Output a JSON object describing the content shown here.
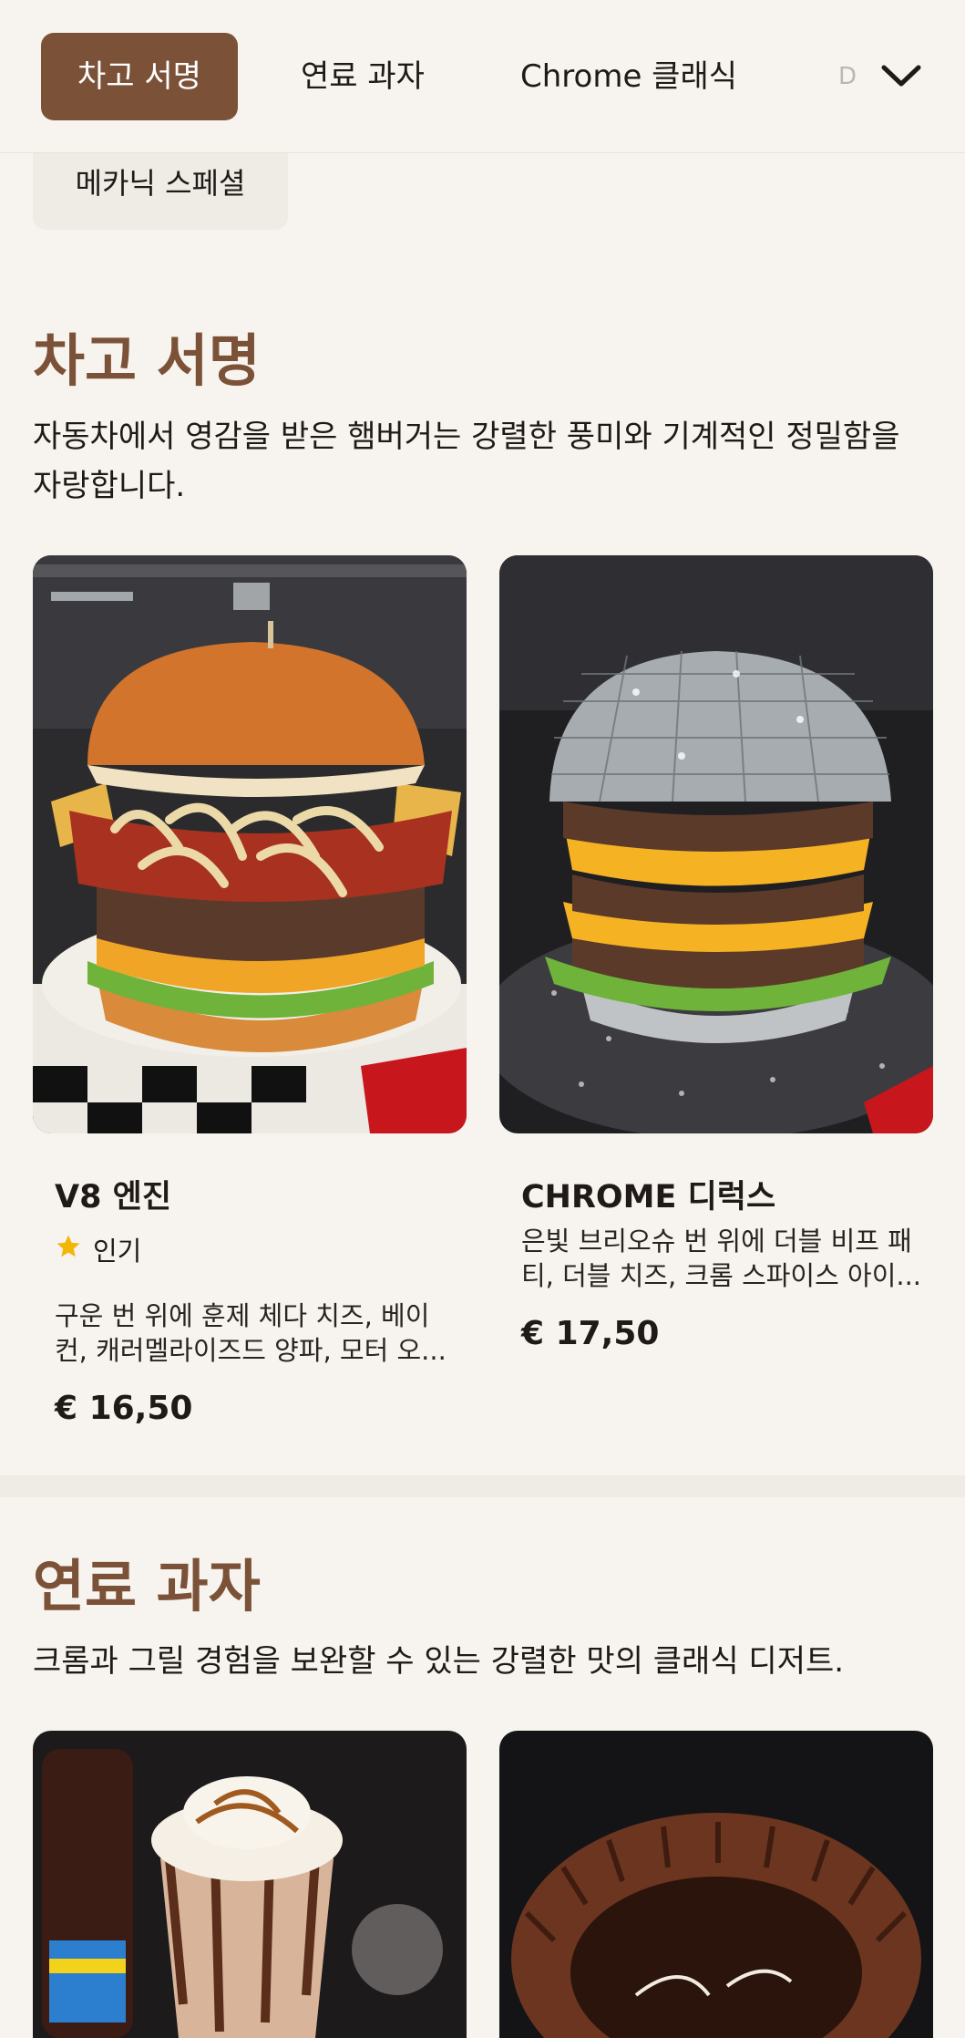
{
  "tabs": [
    {
      "label": "차고 서명"
    },
    {
      "label": "연료 과자"
    },
    {
      "label": "Chrome 클래식"
    },
    {
      "label": "D"
    },
    {
      "label": "메카닉 스페셜"
    }
  ],
  "sections": [
    {
      "title": "차고 서명",
      "description": "자동차에서 영감을 받은 햄버거는 강렬한 풍미와 기계적인 정밀함을 자랑합니다.",
      "items": [
        {
          "title": "V8 엔진",
          "badge": "인기",
          "description": "구운 번 위에 훈제 체다 치즈, 베이컨, 캐러멜라이즈드 양파, 모터 오...",
          "price": "€ 16,50"
        },
        {
          "title": "CHROME 디럭스",
          "description": "은빛 브리오슈 번 위에 더블 비프 패티, 더블 치즈, 크롬 스파이스 아이...",
          "price": "€ 17,50"
        }
      ]
    },
    {
      "title": "연료 과자",
      "description": "크롬과 그릴 경험을 보완할 수 있는 강렬한 맛의 클래식 디저트."
    }
  ],
  "colors": {
    "accent": "#7b5238",
    "background": "#f7f4ef",
    "star": "#f2b705"
  },
  "icons": {
    "dropdown": "chevron-down-icon",
    "popular": "star-icon"
  }
}
